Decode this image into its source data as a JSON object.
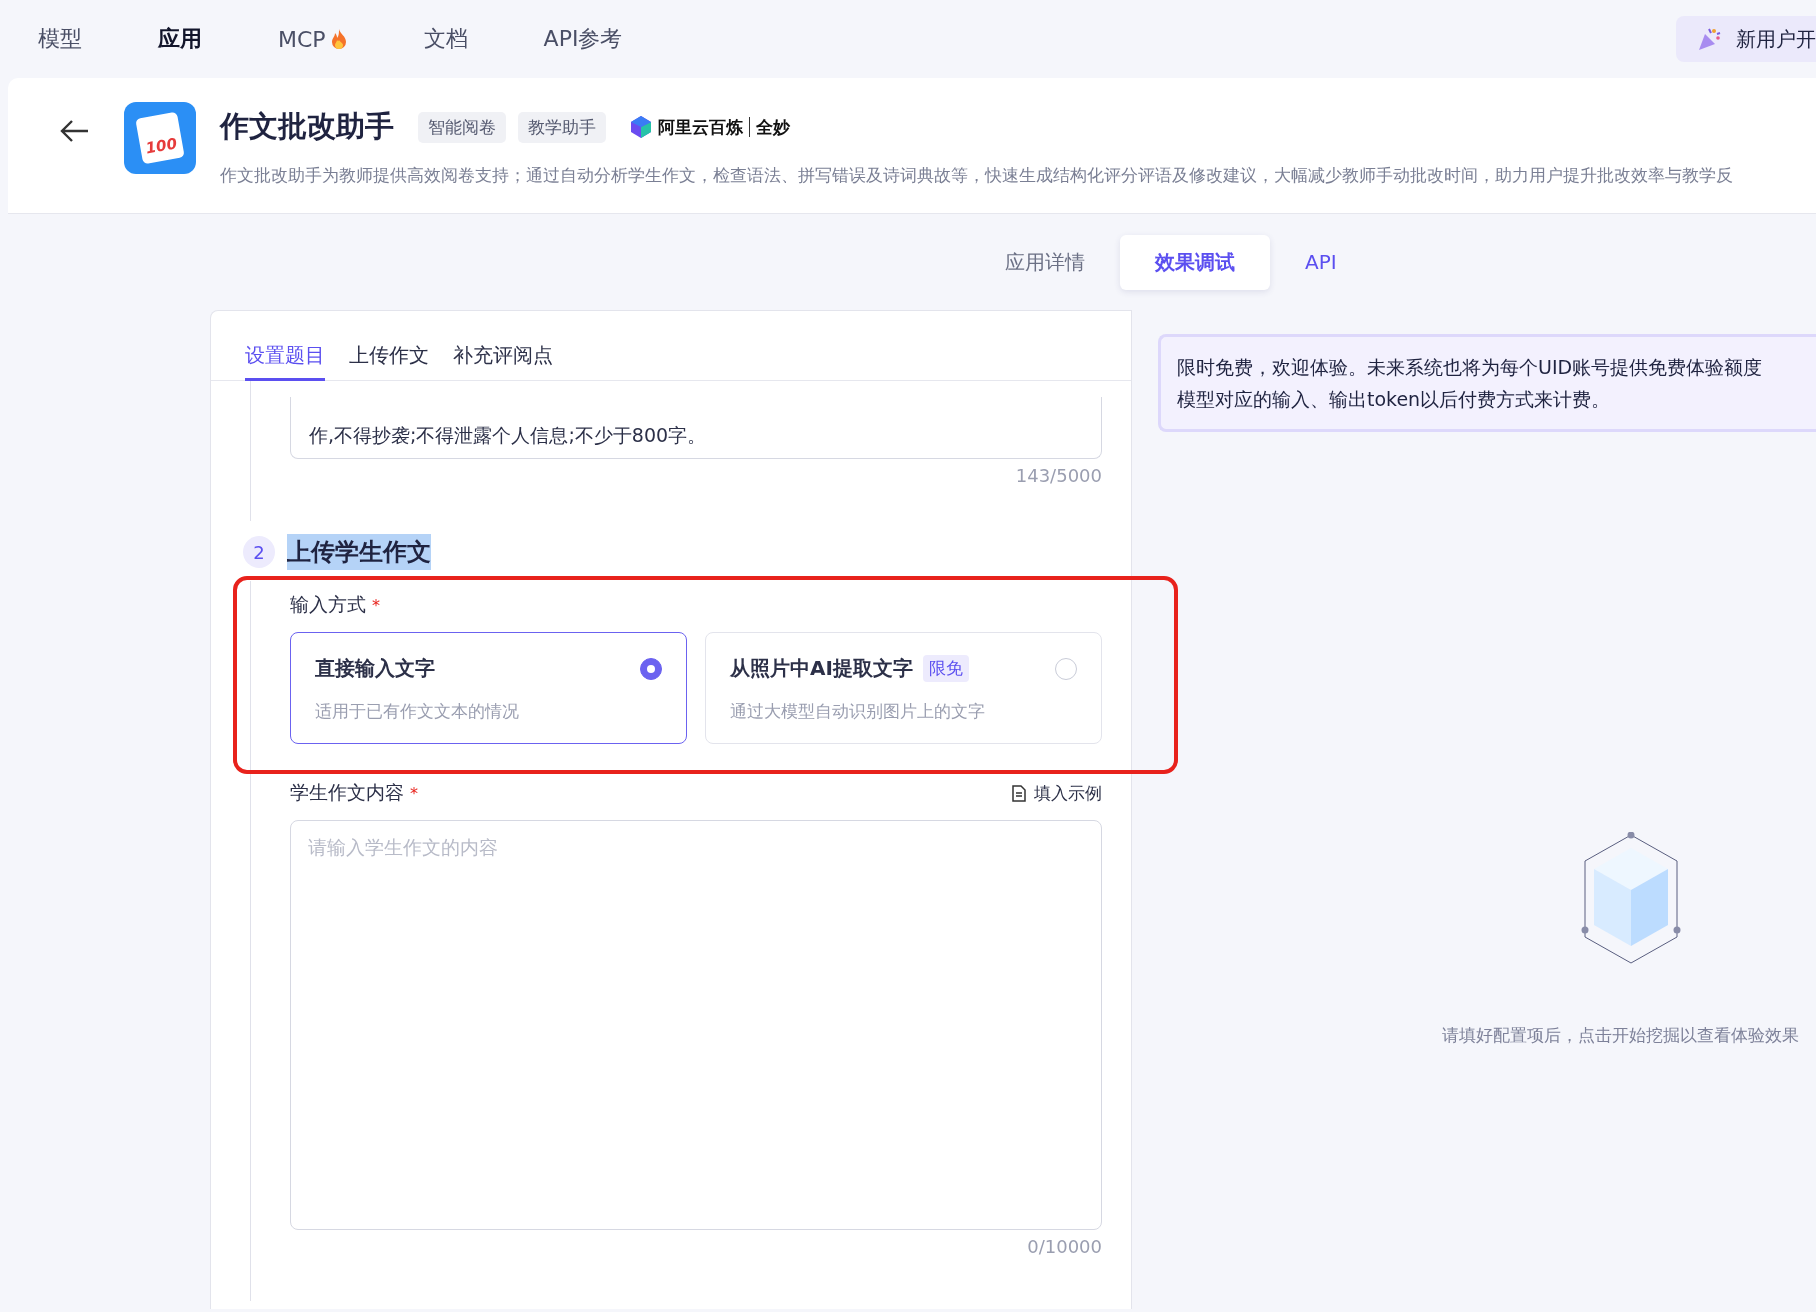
{
  "nav": {
    "items": [
      {
        "label": "模型",
        "selected": false,
        "hot": false
      },
      {
        "label": "应用",
        "selected": true,
        "hot": false
      },
      {
        "label": "MCP",
        "selected": false,
        "hot": true
      },
      {
        "label": "文档",
        "selected": false,
        "hot": false
      },
      {
        "label": "API参考",
        "selected": false,
        "hot": false
      }
    ],
    "promo": "新用户开"
  },
  "app": {
    "icon_text": "100",
    "title": "作文批改助手",
    "tags": [
      "智能阅卷",
      "教学助手"
    ],
    "brand": {
      "name": "阿里云百炼",
      "partner": "全妙"
    },
    "description": "作文批改助手为教师提供高效阅卷支持；通过自动分析学生作文，检查语法、拼写错误及诗词典故等，快速生成结构化评分评语及修改建议，大幅减少教师手动批改时间，助力用户提升批改效率与教学反"
  },
  "view_tabs": [
    {
      "label": "应用详情",
      "selected": false
    },
    {
      "label": "效果调试",
      "selected": true
    },
    {
      "label": "API",
      "selected": false
    }
  ],
  "form": {
    "tabs": [
      {
        "label": "设置题目",
        "selected": true
      },
      {
        "label": "上传作文",
        "selected": false
      },
      {
        "label": "补充评阅点",
        "selected": false
      }
    ],
    "topic": {
      "value": "作,不得抄袭;不得泄露个人信息;不少于800字。",
      "counter": "143/5000"
    },
    "step": {
      "number": "2",
      "title": "上传学生作文",
      "text_selected": true
    },
    "input_method": {
      "label": "输入方式",
      "required_mark": "*",
      "highlighted": true,
      "options": [
        {
          "title": "直接输入文字",
          "subtitle": "适用于已有作文文本的情况",
          "selected": true
        },
        {
          "title": "从照片中AI提取文字",
          "badge": "限免",
          "subtitle": "通过大模型自动识别图片上的文字",
          "selected": false
        }
      ]
    },
    "content": {
      "label": "学生作文内容",
      "required_mark": "*",
      "action": "填入示例",
      "placeholder": "请输入学生作文的内容",
      "counter": "0/10000"
    }
  },
  "result": {
    "notice": [
      "限时免费，欢迎体验。未来系统也将为每个UID账号提供免费体验额度",
      "模型对应的输入、输出token以后付费方式来计费。"
    ],
    "empty_hint": "请填好配置项后，点击开始挖掘以查看体验效果"
  }
}
